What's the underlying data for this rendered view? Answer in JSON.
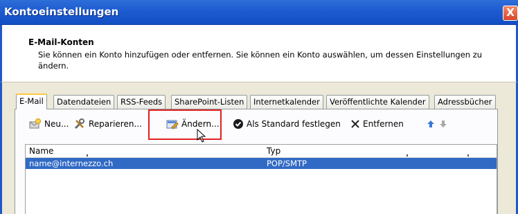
{
  "window": {
    "title": "Kontoeinstellungen",
    "close_label": "X"
  },
  "header": {
    "heading": "E-Mail-Konten",
    "description": "Sie können ein Konto hinzufügen oder entfernen. Sie können ein Konto auswählen, um dessen Einstellungen zu ändern."
  },
  "tabs": [
    {
      "label": "E-Mail",
      "active": true
    },
    {
      "label": "Datendateien",
      "active": false
    },
    {
      "label": "RSS-Feeds",
      "active": false
    },
    {
      "label": "SharePoint-Listen",
      "active": false
    },
    {
      "label": "Internetkalender",
      "active": false
    },
    {
      "label": "Veröffentlichte Kalender",
      "active": false
    },
    {
      "label": "Adressbücher",
      "active": false
    }
  ],
  "toolbar": {
    "new_label": "Neu...",
    "repair_label": "Reparieren...",
    "change_label": "Ändern...",
    "default_label": "Als Standard festlegen",
    "remove_label": "Entfernen"
  },
  "list": {
    "columns": [
      "Name",
      "Typ"
    ],
    "rows": [
      {
        "name": "name@internezzo.ch",
        "type": "POP/SMTP",
        "selected": true
      }
    ]
  },
  "colors": {
    "titlebar": "#1d5bd0",
    "selection": "#316ac5",
    "highlight": "#e02020",
    "active_tab_accent": "#ffc73c"
  }
}
